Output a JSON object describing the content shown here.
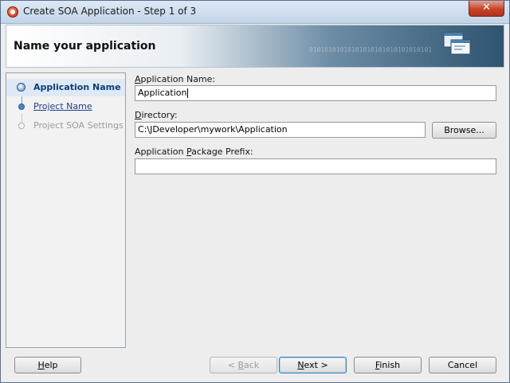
{
  "window": {
    "title": "Create SOA Application - Step 1 of 3",
    "close_symbol": "✕"
  },
  "banner": {
    "heading": "Name your application",
    "binary_text": "01010101010101010101010101010101",
    "icon": "wizard-windows-icon"
  },
  "steps": [
    {
      "label": "Application Name",
      "state": "active"
    },
    {
      "label": "Project Name",
      "state": "link"
    },
    {
      "label": "Project SOA Settings",
      "state": "disabled"
    }
  ],
  "form": {
    "app_name": {
      "label_mnemonic": "A",
      "label_rest": "pplication Name:",
      "value": "Application"
    },
    "directory": {
      "label_mnemonic": "D",
      "label_rest": "irectory:",
      "value": "C:\\JDeveloper\\mywork\\Application",
      "browse_pre": "Browse",
      "browse_mnemonic": "",
      "browse_post": "..."
    },
    "package_prefix": {
      "label_pre": "Application ",
      "label_mnemonic": "P",
      "label_rest": "ackage Prefix:",
      "value": ""
    }
  },
  "buttons": {
    "help": {
      "mnemonic": "H",
      "rest": "elp"
    },
    "back": {
      "pre": "< ",
      "mnemonic": "B",
      "rest": "ack"
    },
    "next": {
      "mnemonic": "N",
      "rest": "ext >"
    },
    "finish": {
      "mnemonic": "F",
      "rest": "inish"
    },
    "cancel": {
      "label": "Cancel"
    }
  },
  "colors": {
    "accent": "#4a88c8",
    "close_button": "#c5432b"
  }
}
